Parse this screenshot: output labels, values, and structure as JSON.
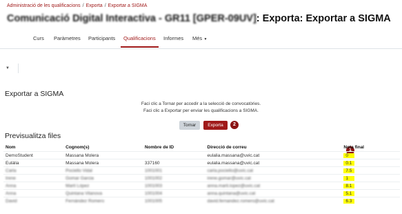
{
  "breadcrumb": [
    "Administració de les qualificacions",
    "Exporta",
    "Exportar a SIGMA"
  ],
  "title": {
    "course": "Comunicació Digital Interactiva - GR11 [GPER-09UV]",
    "suffix": ": Exporta: Exportar a SIGMA"
  },
  "nav": {
    "tabs": [
      "Curs",
      "Paràmetres",
      "Participants",
      "Qualificacions",
      "Informes",
      "Més"
    ],
    "active": "Qualificacions"
  },
  "section_title": "Exportar a SIGMA",
  "info": {
    "line1": "Faci clic a Tornar per accedir a la selecció de convocatòries.",
    "line2": "Faci clic a Exportar per enviar les qualificacions a SIGMA."
  },
  "buttons": {
    "back": "Tornar",
    "export": "Exporta"
  },
  "badges": {
    "export_step": "2",
    "nota_step": "1"
  },
  "preview_title": "Previsualitza files",
  "table": {
    "headers": [
      "Nom",
      "Cognom(s)",
      "Nombre de ID",
      "Direcció de correu",
      "Nota final"
    ],
    "rows": [
      [
        "DemoStudent",
        "Massana Molera",
        "",
        "eulalia.massana@uvic.cat",
        "0"
      ],
      [
        "Eulàlia",
        "Massana Molera",
        "337160",
        "eulalia.massana@uvic.cat",
        "0.1"
      ],
      [
        "Carla",
        "Pociello Vidal",
        "1001001",
        "carla.pociello@uvic.cat",
        "7.5"
      ],
      [
        "Irene",
        "Gomar Garcia",
        "1001002",
        "irene.gomar@uvic.cat",
        "1"
      ],
      [
        "Anna",
        "Martí López",
        "1001003",
        "anna.marti.lopez@uvic.cat",
        "8.1"
      ],
      [
        "Anna",
        "Quintana Vilanova",
        "1001004",
        "anna.quintana@uvic.cat",
        "5.1"
      ],
      [
        "David",
        "Fernández Romero",
        "1001005",
        "david.fernandez.romero@uvic.cat",
        "6.3"
      ]
    ],
    "blurred_from_row": 2
  },
  "colors": {
    "accent": "#a01a1a",
    "highlight": "#ffff00",
    "badge": "#8b1414"
  }
}
